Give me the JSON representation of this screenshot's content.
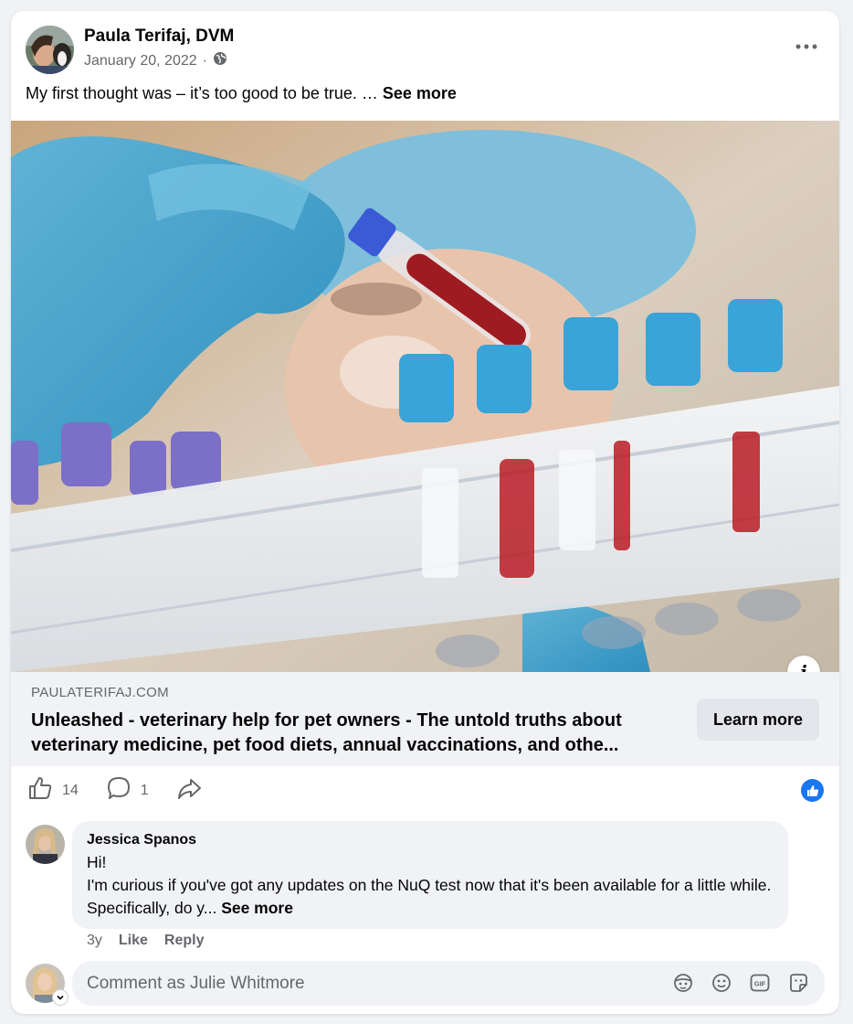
{
  "post": {
    "author": "Paula Terifaj, DVM",
    "date": "January 20, 2022",
    "separator": "·",
    "audience_icon": "globe-icon",
    "text": "My first thought was – it’s too good to be true. … ",
    "see_more": "See more"
  },
  "link": {
    "domain": "PAULATERIFAJ.COM",
    "title": "Unleashed - veterinary help for pet owners - The untold truths about veterinary medicine, pet food diets, annual vaccinations, and othe...",
    "button": "Learn more",
    "info_icon": "i"
  },
  "actions": {
    "likes": "14",
    "comments": "1"
  },
  "comment": {
    "author": "Jessica Spanos",
    "line1": "Hi!",
    "line2": "I'm curious if you've got any updates on the NuQ test now that it's been available for a little while. Specifically, do y... ",
    "see_more": "See more",
    "age": "3y",
    "like": "Like",
    "reply": "Reply"
  },
  "composer": {
    "placeholder": "Comment as Julie Whitmore"
  },
  "colors": {
    "brand": "#1877f2",
    "secondary_text": "#65676b",
    "surface": "#f0f2f5"
  }
}
